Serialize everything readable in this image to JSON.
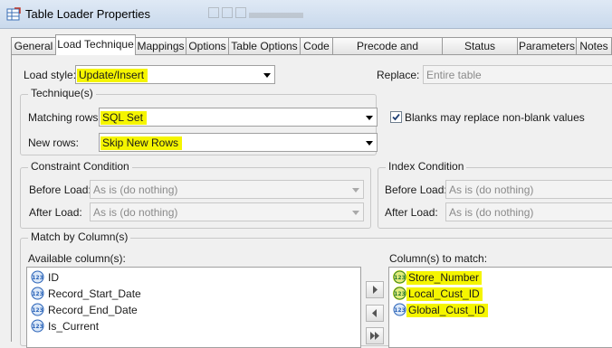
{
  "window": {
    "title": "Table Loader Properties",
    "app_icon": "table-loader-icon"
  },
  "tabs": [
    "General",
    "Load Technique",
    "Mappings",
    "Options",
    "Table Options",
    "Code",
    "Precode and Postcode",
    "Status Handling",
    "Parameters",
    "Notes"
  ],
  "active_tab": "Load Technique",
  "load_style": {
    "label": "Load style:",
    "value": "Update/Insert"
  },
  "replace": {
    "label": "Replace:",
    "value": "Entire table"
  },
  "technique": {
    "title": "Technique(s)",
    "matching_rows": {
      "label": "Matching rows:",
      "value": "SQL Set"
    },
    "new_rows": {
      "label": "New rows:",
      "value": "Skip New Rows"
    },
    "blanks_checkbox": {
      "label": "Blanks may replace non-blank values",
      "checked": true
    }
  },
  "constraint": {
    "title": "Constraint Condition",
    "before_label": "Before Load:",
    "before_value": "As is (do nothing)",
    "after_label": "After Load:",
    "after_value": "As is (do nothing)"
  },
  "index": {
    "title": "Index Condition",
    "before_label": "Before Load:",
    "before_value": "As is (do nothing)",
    "after_label": "After Load:",
    "after_value": "As is (do nothing)"
  },
  "match_by": {
    "title": "Match by Column(s)",
    "available_label": "Available column(s):",
    "available": [
      "ID",
      "Record_Start_Date",
      "Record_End_Date",
      "Is_Current"
    ],
    "to_match_label": "Column(s) to match:",
    "to_match": [
      "Store_Number",
      "Local_Cust_ID",
      "Global_Cust_ID"
    ],
    "column_icon": "numeric-column-icon",
    "highlight_color": "#f5f500"
  }
}
